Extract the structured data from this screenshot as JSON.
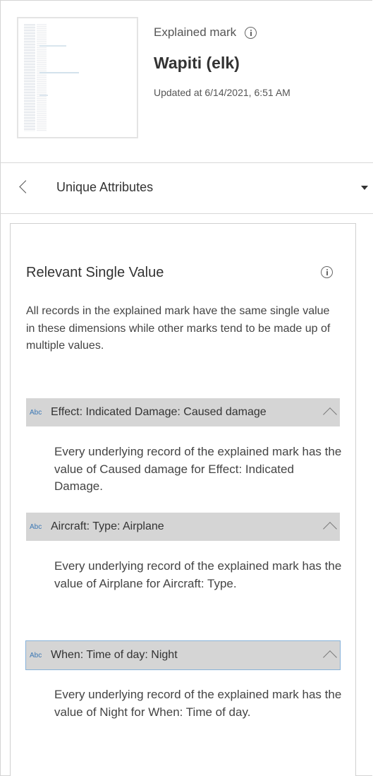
{
  "header": {
    "explained_mark_label": "Explained mark",
    "mark_title": "Wapiti (elk)",
    "updated_text": "Updated at 6/14/2021, 6:51 AM",
    "thumbnail_icon": "viz-thumbnail",
    "info_icon": "info-icon"
  },
  "nav": {
    "back_icon": "chevron-left-icon",
    "title": "Unique Attributes",
    "dropdown_icon": "caret-down-icon"
  },
  "card": {
    "title": "Relevant Single Value",
    "description": "All records in the explained mark have the same single value in these dimensions while other marks tend to be made up of multiple values.",
    "attributes": [
      {
        "type_icon": "Abc",
        "name": "Effect: Indicated Damage: Caused damage",
        "expanded": true,
        "detail": "Every underlying record of the explained mark has the value of Caused damage for Effect: Indicated Damage."
      },
      {
        "type_icon": "Abc",
        "name": "Aircraft: Type: Airplane",
        "expanded": true,
        "detail": "Every underlying record of the explained mark has the value of Airplane for Aircraft: Type."
      },
      {
        "type_icon": "Abc",
        "name": "When: Time of day: Night",
        "expanded": true,
        "focused": true,
        "detail": "Every underlying record of the explained mark has the value of Night for When: Time of day."
      }
    ]
  },
  "colors": {
    "accent": "#3b78b5",
    "header_bar": "#d5d5d5",
    "focus_ring": "#8ab4d9",
    "text": "#333333"
  }
}
